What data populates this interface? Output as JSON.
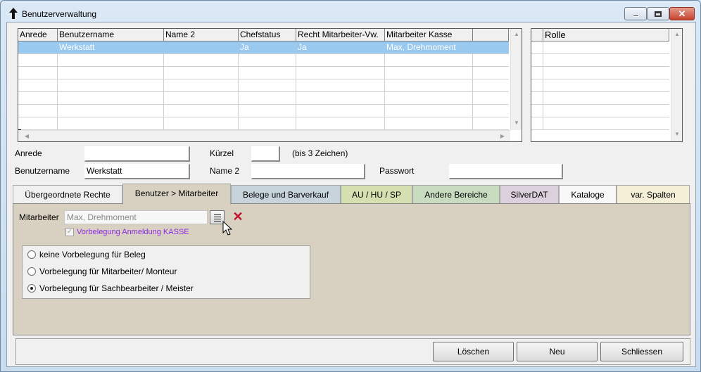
{
  "window": {
    "title": "Benutzerverwaltung"
  },
  "user_grid": {
    "columns": [
      "Anrede",
      "Benutzername",
      "Name 2",
      "Chefstatus",
      "Recht Mitarbeiter-Vw.",
      "Mitarbeiter Kasse"
    ],
    "rows": [
      {
        "anrede": "",
        "benutzername": "Werkstatt",
        "name2": "",
        "chefstatus": "Ja",
        "recht": "Ja",
        "kasse": "Max, Drehmoment"
      }
    ]
  },
  "role_grid": {
    "columns": [
      "Rolle"
    ]
  },
  "form": {
    "anrede_label": "Anrede",
    "anrede_value": "",
    "kuerzel_label": "Kürzel",
    "kuerzel_value": "",
    "kuerzel_hint": "(bis 3 Zeichen)",
    "benutzername_label": "Benutzername",
    "benutzername_value": "Werkstatt",
    "name2_label": "Name 2",
    "name2_value": "",
    "passwort_label": "Passwort",
    "passwort_value": ""
  },
  "tabs": [
    {
      "label": "Übergeordnete Rechte",
      "color": "#f0f0f0"
    },
    {
      "label": "Benutzer > Mitarbeiter",
      "color": "#d8d0c0"
    },
    {
      "label": "Belege und Barverkauf",
      "color": "#c8d4dc"
    },
    {
      "label": "AU / HU / SP",
      "color": "#d4e0b0"
    },
    {
      "label": "Andere Bereiche",
      "color": "#c8dcc0"
    },
    {
      "label": "SilverDAT",
      "color": "#dcd0dc"
    },
    {
      "label": "Kataloge",
      "color": "#f8f8f8"
    },
    {
      "label": "var. Spalten",
      "color": "#f4f0d8"
    }
  ],
  "active_tab": "Benutzer > Mitarbeiter",
  "panel": {
    "mitarbeiter_label": "Mitarbeiter",
    "mitarbeiter_value": "Max, Drehmoment",
    "checkbox_label": "Vorbelegung Anmeldung KASSE",
    "checkbox_checked": true,
    "radio_options": [
      {
        "label": "keine Vorbelegung für Beleg",
        "selected": false
      },
      {
        "label": "Vorbelegung für Mitarbeiter/ Monteur",
        "selected": false
      },
      {
        "label": "Vorbelegung für Sachbearbeiter / Meister",
        "selected": true
      }
    ]
  },
  "buttons": {
    "loeschen": "Löschen",
    "neu": "Neu",
    "schliessen": "Schliessen"
  },
  "icons": {
    "app": "up-arrow-icon",
    "minimize": "minimize-icon",
    "maximize": "maximize-icon",
    "close": "close-icon",
    "list": "list-icon",
    "clear": "x-clear-icon",
    "cursor": "mouse-pointer-icon"
  }
}
